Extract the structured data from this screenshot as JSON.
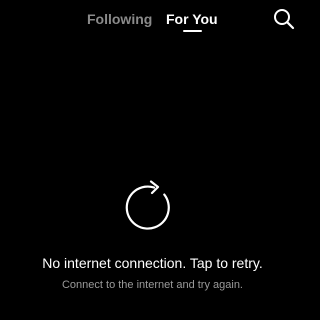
{
  "top_nav": {
    "tabs": [
      {
        "label": "Following",
        "active": false
      },
      {
        "label": "For You",
        "active": true
      }
    ],
    "search_icon": "search-icon"
  },
  "error_state": {
    "icon": "retry-icon",
    "title": "No internet connection. Tap to retry.",
    "subtitle": "Connect to the internet and try again."
  },
  "colors": {
    "background": "#000000",
    "active_tab": "#ffffff",
    "inactive_tab": "#8a8a8a",
    "subtitle": "#9a9a9a"
  }
}
